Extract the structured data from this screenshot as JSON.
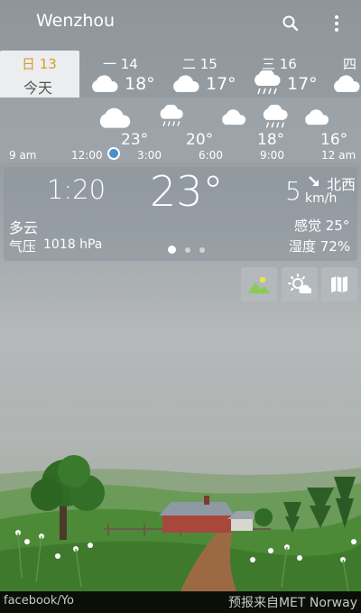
{
  "header": {
    "city": "Wenzhou",
    "search_icon": "search-icon",
    "more_icon": "more-vert-icon"
  },
  "daily": [
    {
      "day": "日 13",
      "label": "今天",
      "today": true
    },
    {
      "day": "一 14",
      "temp": "18°",
      "icon": "cloud-icon"
    },
    {
      "day": "二 15",
      "temp": "17°",
      "icon": "cloud-icon"
    },
    {
      "day": "三 16",
      "temp": "17°",
      "icon": "rain-cloud-icon"
    },
    {
      "day": "四",
      "icon": "cloud-icon"
    }
  ],
  "hourly": [
    {
      "time": "9 am",
      "icon": ""
    },
    {
      "time": "12:00",
      "temp": "23°",
      "icon": "cloud-icon"
    },
    {
      "time": "3:00",
      "temp": "",
      "icon": "rain-cloud-icon"
    },
    {
      "time": "6:00",
      "temp": "20°",
      "icon": "cloud-icon"
    },
    {
      "time": "9:00",
      "temp": "18°",
      "icon": "rain-cloud-icon"
    },
    {
      "time": "12 am",
      "temp": "16°",
      "icon": "cloud-icon"
    }
  ],
  "current": {
    "time": "1:20",
    "temp": "23°",
    "wind_speed": "5",
    "wind_dir": "北西",
    "wind_unit": "km/h",
    "condition": "多云",
    "pressure_label": "气压",
    "pressure_value": "1018 hPa",
    "feels_like": "感觉 25°",
    "humidity": "湿度 72%",
    "page_count": 3,
    "active_page": 1
  },
  "buttons": [
    {
      "name": "landscape-button",
      "icon": "landscape-icon"
    },
    {
      "name": "sun-cycle-button",
      "icon": "sun-cloud-icon"
    },
    {
      "name": "map-button",
      "icon": "map-icon"
    }
  ],
  "footer": {
    "left": "facebook/Yo",
    "right": "预报来自MET Norway"
  },
  "colors": {
    "accent": "#4a8fd0",
    "today_text": "#d99a32",
    "footer_bg": "#0b0f08"
  }
}
